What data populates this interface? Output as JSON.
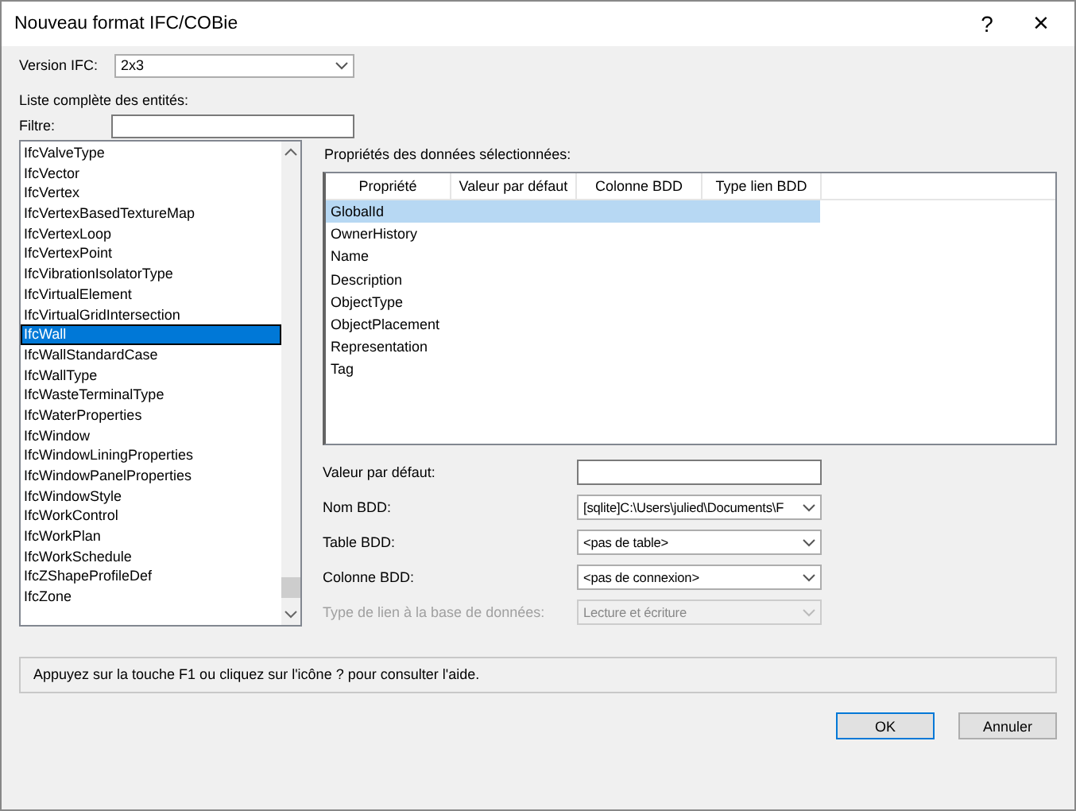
{
  "window": {
    "title": "Nouveau format IFC/COBie",
    "help_glyph": "?",
    "close_glyph": "×"
  },
  "version": {
    "label": "Version IFC:",
    "value": "2x3"
  },
  "entity_list": {
    "heading": "Liste complète des entités:",
    "filter_label": "Filtre:",
    "items": [
      {
        "label": "IfcValveType",
        "selected": false
      },
      {
        "label": "IfcVector",
        "selected": false
      },
      {
        "label": "IfcVertex",
        "selected": false
      },
      {
        "label": "IfcVertexBasedTextureMap",
        "selected": false
      },
      {
        "label": "IfcVertexLoop",
        "selected": false
      },
      {
        "label": "IfcVertexPoint",
        "selected": false
      },
      {
        "label": "IfcVibrationIsolatorType",
        "selected": false
      },
      {
        "label": "IfcVirtualElement",
        "selected": false
      },
      {
        "label": "IfcVirtualGridIntersection",
        "selected": false
      },
      {
        "label": "IfcWall",
        "selected": true
      },
      {
        "label": "IfcWallStandardCase",
        "selected": false
      },
      {
        "label": "IfcWallType",
        "selected": false
      },
      {
        "label": "IfcWasteTerminalType",
        "selected": false
      },
      {
        "label": "IfcWaterProperties",
        "selected": false
      },
      {
        "label": "IfcWindow",
        "selected": false
      },
      {
        "label": "IfcWindowLiningProperties",
        "selected": false
      },
      {
        "label": "IfcWindowPanelProperties",
        "selected": false
      },
      {
        "label": "IfcWindowStyle",
        "selected": false
      },
      {
        "label": "IfcWorkControl",
        "selected": false
      },
      {
        "label": "IfcWorkPlan",
        "selected": false
      },
      {
        "label": "IfcWorkSchedule",
        "selected": false
      },
      {
        "label": "IfcZShapeProfileDef",
        "selected": false
      },
      {
        "label": "IfcZone",
        "selected": false
      }
    ]
  },
  "properties": {
    "heading": "Propriétés des données sélectionnées:",
    "columns": [
      "Propriété",
      "Valeur par défaut",
      "Colonne BDD",
      "Type lien BDD"
    ],
    "rows": [
      {
        "name": "GlobalId",
        "selected": true
      },
      {
        "name": "OwnerHistory",
        "selected": false
      },
      {
        "name": "Name",
        "selected": false
      },
      {
        "name": "Description",
        "selected": false
      },
      {
        "name": "ObjectType",
        "selected": false
      },
      {
        "name": "ObjectPlacement",
        "selected": false
      },
      {
        "name": "Representation",
        "selected": false
      },
      {
        "name": "Tag",
        "selected": false
      }
    ]
  },
  "fields": [
    {
      "kind": "text",
      "label": "Valeur par défaut:",
      "disabled": false
    },
    {
      "kind": "dropdown",
      "label": "Nom BDD:",
      "value": "[sqlite]C:\\Users\\julied\\Documents\\F",
      "disabled": false
    },
    {
      "kind": "dropdown",
      "label": "Table BDD:",
      "value": "<pas de table>",
      "disabled": false
    },
    {
      "kind": "dropdown",
      "label": "Colonne BDD:",
      "value": "<pas de connexion>",
      "disabled": false
    },
    {
      "kind": "dropdown",
      "label": "Type de lien à la base de données:",
      "value": "Lecture et écriture",
      "disabled": true
    }
  ],
  "status": "Appuyez sur la touche F1 ou cliquez sur l'icône ? pour consulter l'aide.",
  "buttons": [
    {
      "label": "OK",
      "default": true
    },
    {
      "label": "Annuler",
      "default": false
    }
  ]
}
